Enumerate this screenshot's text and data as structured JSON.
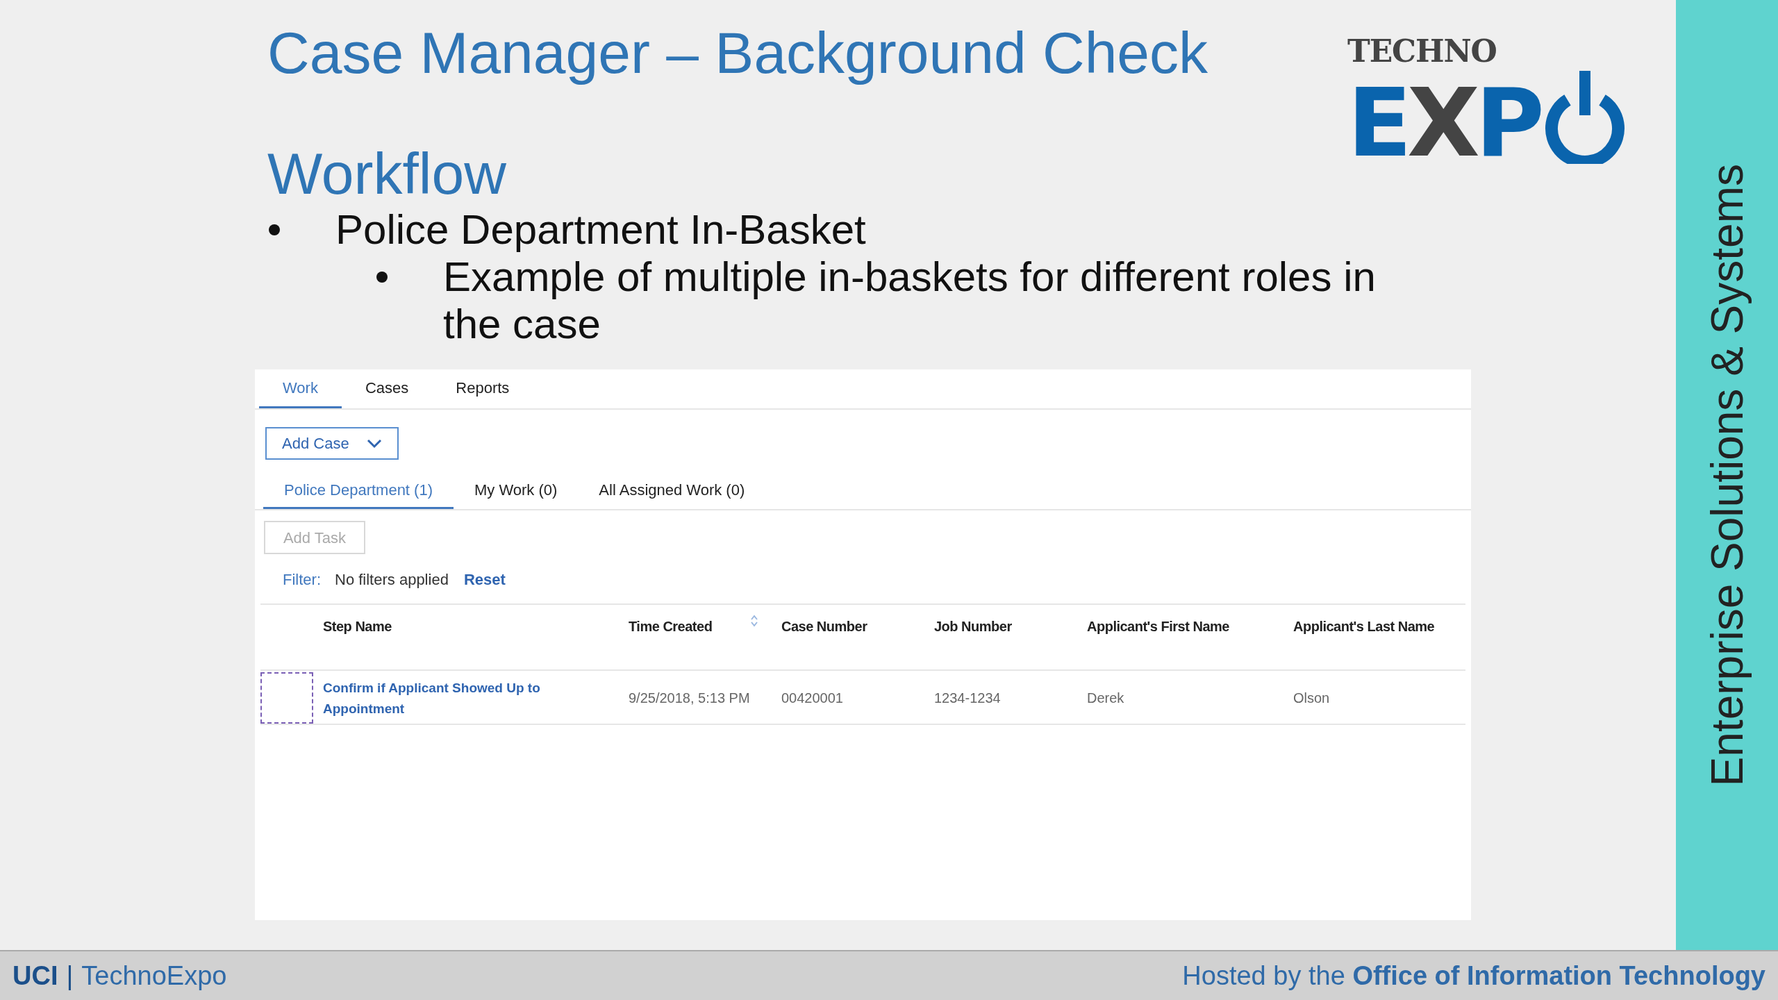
{
  "slide": {
    "title": "Case Manager – Background Check",
    "subtitle": "Workflow",
    "bullets": [
      {
        "text": "Police Department In-Basket",
        "children": [
          {
            "text": "Example of multiple in-baskets for different roles in the case"
          }
        ]
      }
    ],
    "logo": {
      "top": "TECHNO",
      "main": "EXP"
    },
    "side_label": "Enterprise Solutions & Systems",
    "footer": {
      "left_bold": "UCI",
      "separator": "|",
      "left": "TechnoExpo",
      "right": "Hosted by the **Office of Information Technology**"
    }
  },
  "app": {
    "tabs": [
      {
        "label": "Work",
        "selected": true
      },
      {
        "label": "Cases",
        "selected": false
      },
      {
        "label": "Reports",
        "selected": false
      }
    ],
    "add_case": "Add Case",
    "sub_tabs": [
      {
        "label": "Police Department (1)",
        "selected": true
      },
      {
        "label": "My Work (0)",
        "selected": false
      },
      {
        "label": "All Assigned Work (0)",
        "selected": false
      }
    ],
    "add_task": {
      "label": "Add Task",
      "disabled": true
    },
    "filter": {
      "label": "Filter:",
      "value": "No filters applied",
      "reset": "Reset"
    },
    "table": {
      "columns": [
        "Step Name",
        "Time Created",
        "Case Number",
        "Job Number",
        "Applicant's First Name",
        "Applicant's Last Name"
      ],
      "rows": [
        {
          "selected": false,
          "cells": [
            "Confirm if Applicant Showed Up to Appointment",
            "9/25/2018, 5:13 PM",
            "00420001",
            "1234-1234",
            "Derek",
            "Olson"
          ]
        }
      ]
    }
  }
}
